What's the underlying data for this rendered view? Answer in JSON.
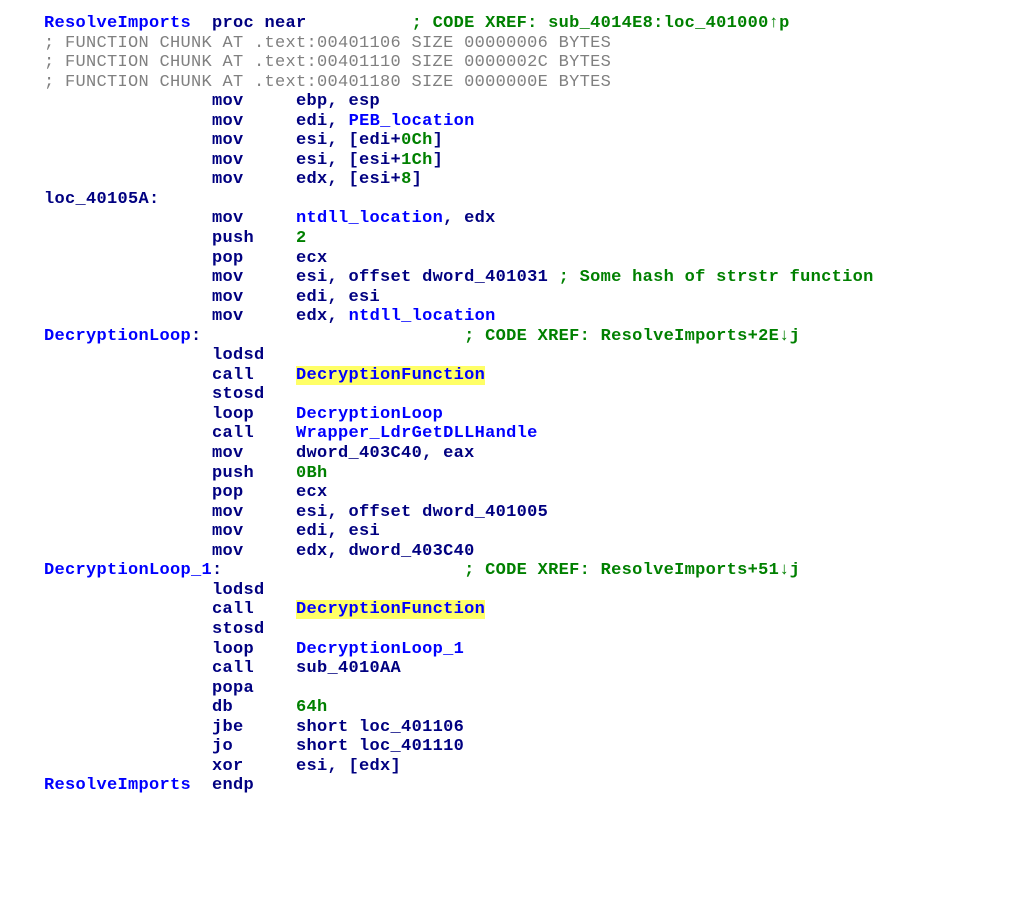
{
  "lines": [
    {
      "indent": 0,
      "parts": [
        {
          "cls": "sym",
          "text": "ResolveImports"
        },
        {
          "cls": "kw",
          "text": "  proc near          "
        },
        {
          "cls": "cmnt",
          "text": "; CODE XREF: sub_4014E8:loc_401000↑p"
        }
      ]
    },
    {
      "indent": 0,
      "parts": [
        {
          "cls": "kw",
          "text": ""
        }
      ]
    },
    {
      "indent": 0,
      "parts": [
        {
          "cls": "gray",
          "text": "; FUNCTION CHUNK AT .text:00401106 SIZE 00000006 BYTES"
        }
      ]
    },
    {
      "indent": 0,
      "parts": [
        {
          "cls": "gray",
          "text": "; FUNCTION CHUNK AT .text:00401110 SIZE 0000002C BYTES"
        }
      ]
    },
    {
      "indent": 0,
      "parts": [
        {
          "cls": "gray",
          "text": "; FUNCTION CHUNK AT .text:00401180 SIZE 0000000E BYTES"
        }
      ]
    },
    {
      "indent": 0,
      "parts": [
        {
          "cls": "kw",
          "text": ""
        }
      ]
    },
    {
      "indent": 1,
      "parts": [
        {
          "cls": "kw",
          "text": "mov     ebp, esp"
        }
      ]
    },
    {
      "indent": 1,
      "parts": [
        {
          "cls": "kw",
          "text": "mov     edi, "
        },
        {
          "cls": "sym",
          "text": "PEB_location"
        }
      ]
    },
    {
      "indent": 1,
      "parts": [
        {
          "cls": "kw",
          "text": "mov     esi, [edi+"
        },
        {
          "cls": "num",
          "text": "0Ch"
        },
        {
          "cls": "kw",
          "text": "]"
        }
      ]
    },
    {
      "indent": 1,
      "parts": [
        {
          "cls": "kw",
          "text": "mov     esi, [esi+"
        },
        {
          "cls": "num",
          "text": "1Ch"
        },
        {
          "cls": "kw",
          "text": "]"
        }
      ]
    },
    {
      "indent": 1,
      "parts": [
        {
          "cls": "kw",
          "text": "mov     edx, [esi+"
        },
        {
          "cls": "num",
          "text": "8"
        },
        {
          "cls": "kw",
          "text": "]"
        }
      ]
    },
    {
      "indent": 0,
      "parts": [
        {
          "cls": "kw",
          "text": ""
        }
      ]
    },
    {
      "indent": 0,
      "parts": [
        {
          "cls": "kw",
          "text": "loc_40105A:"
        }
      ]
    },
    {
      "indent": 1,
      "parts": [
        {
          "cls": "kw",
          "text": "mov     "
        },
        {
          "cls": "sym",
          "text": "ntdll_location"
        },
        {
          "cls": "kw",
          "text": ", edx"
        }
      ]
    },
    {
      "indent": 1,
      "parts": [
        {
          "cls": "kw",
          "text": "push    "
        },
        {
          "cls": "num",
          "text": "2"
        }
      ]
    },
    {
      "indent": 1,
      "parts": [
        {
          "cls": "kw",
          "text": "pop     ecx"
        }
      ]
    },
    {
      "indent": 1,
      "parts": [
        {
          "cls": "kw",
          "text": "mov     esi, offset dword_401031 "
        },
        {
          "cls": "cmnt",
          "text": "; Some hash of strstr function"
        }
      ]
    },
    {
      "indent": 1,
      "parts": [
        {
          "cls": "kw",
          "text": "mov     edi, esi"
        }
      ]
    },
    {
      "indent": 1,
      "parts": [
        {
          "cls": "kw",
          "text": "mov     edx, "
        },
        {
          "cls": "sym",
          "text": "ntdll_location"
        }
      ]
    },
    {
      "indent": 0,
      "parts": [
        {
          "cls": "kw",
          "text": ""
        }
      ]
    },
    {
      "indent": 0,
      "parts": [
        {
          "cls": "sym",
          "text": "DecryptionLoop"
        },
        {
          "cls": "kw",
          "text": ":                         "
        },
        {
          "cls": "cmnt",
          "text": "; CODE XREF: ResolveImports+2E↓j"
        }
      ]
    },
    {
      "indent": 1,
      "parts": [
        {
          "cls": "kw",
          "text": "lodsd"
        }
      ]
    },
    {
      "indent": 1,
      "parts": [
        {
          "cls": "kw",
          "text": "call    "
        },
        {
          "cls": "sym hl",
          "text": "DecryptionFunction"
        }
      ]
    },
    {
      "indent": 1,
      "parts": [
        {
          "cls": "kw",
          "text": "stosd"
        }
      ]
    },
    {
      "indent": 1,
      "parts": [
        {
          "cls": "kw",
          "text": "loop    "
        },
        {
          "cls": "sym",
          "text": "DecryptionLoop"
        }
      ]
    },
    {
      "indent": 1,
      "parts": [
        {
          "cls": "kw",
          "text": "call    "
        },
        {
          "cls": "sym",
          "text": "Wrapper_LdrGetDLLHandle"
        }
      ]
    },
    {
      "indent": 1,
      "parts": [
        {
          "cls": "kw",
          "text": "mov     dword_403C40, eax"
        }
      ]
    },
    {
      "indent": 1,
      "parts": [
        {
          "cls": "kw",
          "text": "push    "
        },
        {
          "cls": "num",
          "text": "0Bh"
        }
      ]
    },
    {
      "indent": 1,
      "parts": [
        {
          "cls": "kw",
          "text": "pop     ecx"
        }
      ]
    },
    {
      "indent": 1,
      "parts": [
        {
          "cls": "kw",
          "text": "mov     esi, offset dword_401005"
        }
      ]
    },
    {
      "indent": 1,
      "parts": [
        {
          "cls": "kw",
          "text": "mov     edi, esi"
        }
      ]
    },
    {
      "indent": 1,
      "parts": [
        {
          "cls": "kw",
          "text": "mov     edx, dword_403C40"
        }
      ]
    },
    {
      "indent": 0,
      "parts": [
        {
          "cls": "kw",
          "text": ""
        }
      ]
    },
    {
      "indent": 0,
      "parts": [
        {
          "cls": "sym",
          "text": "DecryptionLoop_1"
        },
        {
          "cls": "kw",
          "text": ":                       "
        },
        {
          "cls": "cmnt",
          "text": "; CODE XREF: ResolveImports+51↓j"
        }
      ]
    },
    {
      "indent": 1,
      "parts": [
        {
          "cls": "kw",
          "text": "lodsd"
        }
      ]
    },
    {
      "indent": 1,
      "parts": [
        {
          "cls": "kw",
          "text": "call    "
        },
        {
          "cls": "sym hl",
          "text": "DecryptionFunction"
        }
      ]
    },
    {
      "indent": 1,
      "parts": [
        {
          "cls": "kw",
          "text": "stosd"
        }
      ]
    },
    {
      "indent": 1,
      "parts": [
        {
          "cls": "kw",
          "text": "loop    "
        },
        {
          "cls": "sym",
          "text": "DecryptionLoop_1"
        }
      ]
    },
    {
      "indent": 1,
      "parts": [
        {
          "cls": "kw",
          "text": "call    sub_4010AA"
        }
      ]
    },
    {
      "indent": 1,
      "parts": [
        {
          "cls": "kw",
          "text": "popa"
        }
      ]
    },
    {
      "indent": 1,
      "parts": [
        {
          "cls": "kw",
          "text": "db      "
        },
        {
          "cls": "num",
          "text": "64h"
        }
      ]
    },
    {
      "indent": 1,
      "parts": [
        {
          "cls": "kw",
          "text": "jbe     short loc_401106"
        }
      ]
    },
    {
      "indent": 1,
      "parts": [
        {
          "cls": "kw",
          "text": "jo      short loc_401110"
        }
      ]
    },
    {
      "indent": 1,
      "parts": [
        {
          "cls": "kw",
          "text": "xor     esi, [edx]"
        }
      ]
    },
    {
      "indent": 0,
      "parts": [
        {
          "cls": "sym",
          "text": "ResolveImports"
        },
        {
          "cls": "kw",
          "text": "  endp"
        }
      ]
    }
  ],
  "mnemonic_indent": "                "
}
